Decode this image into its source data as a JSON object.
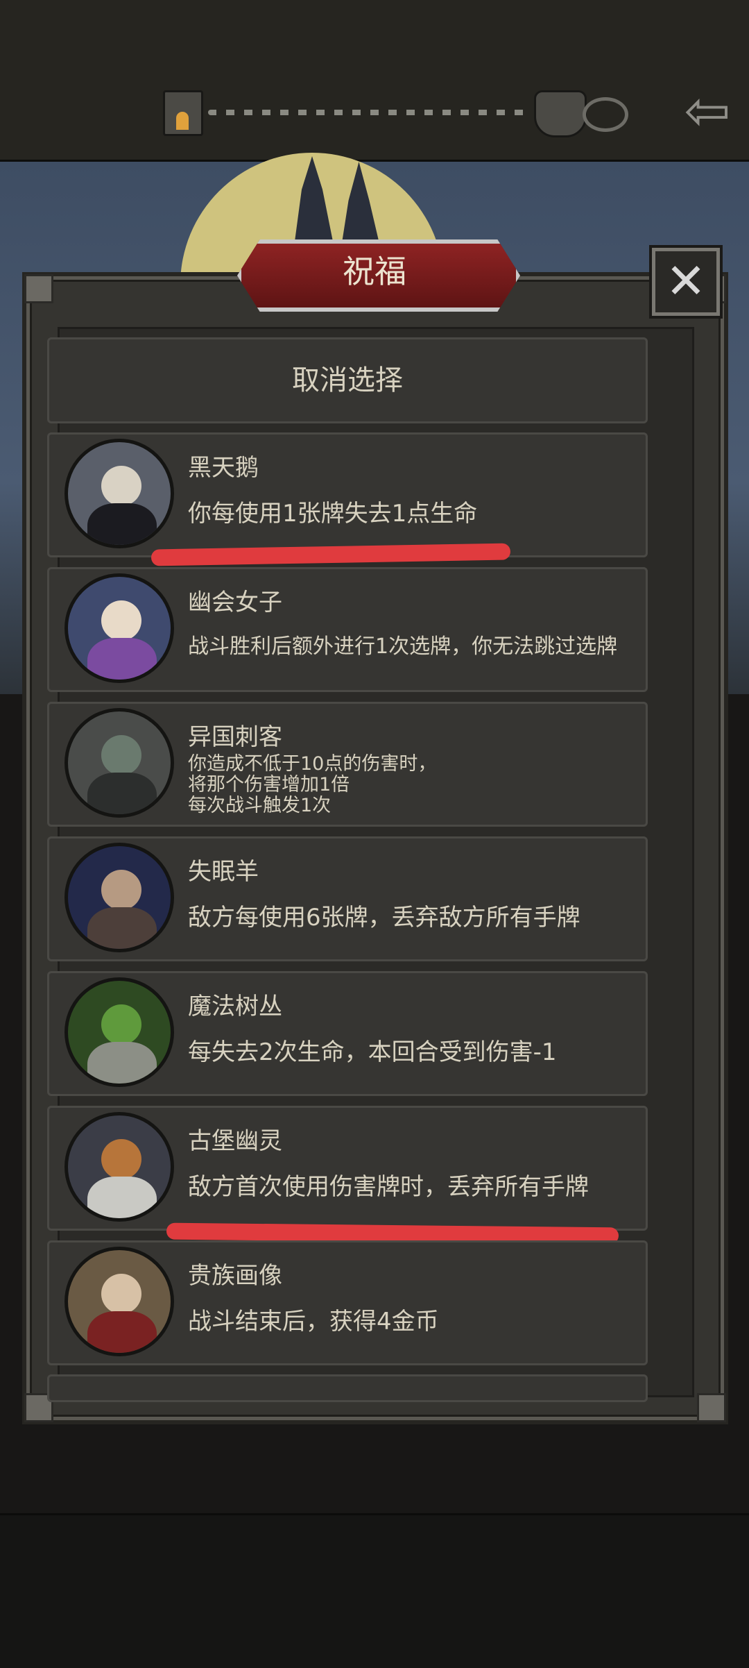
{
  "dialog": {
    "title": "祝福",
    "cancel_label": "取消选择"
  },
  "cards": [
    {
      "name": "黑天鹅",
      "desc": "你每使用1张牌失去1点生命",
      "portrait": "black-swan-portrait"
    },
    {
      "name": "幽会女子",
      "desc": "战斗胜利后额外进行1次选牌，你无法跳过选牌",
      "portrait": "tryst-woman-portrait"
    },
    {
      "name": "异国刺客",
      "desc": "你造成不低于10点的伤害时，\n将那个伤害增加1倍\n每次战斗触发1次",
      "portrait": "foreign-assassin-portrait"
    },
    {
      "name": "失眠羊",
      "desc": "敌方每使用6张牌，丢弃敌方所有手牌",
      "portrait": "insomnia-sheep-portrait"
    },
    {
      "name": "魔法树丛",
      "desc": "每失去2次生命，本回合受到伤害-1",
      "portrait": "magic-bush-portrait"
    },
    {
      "name": "古堡幽灵",
      "desc": "敌方首次使用伤害牌时，丢弃所有手牌",
      "portrait": "castle-ghost-portrait"
    },
    {
      "name": "贵族画像",
      "desc": "战斗结束后，获得4金币",
      "portrait": "noble-portrait-portrait"
    }
  ],
  "colors": {
    "accent_red": "#7c1d1d",
    "text": "#d8d2c0",
    "annotation": "#e03b3e"
  },
  "icons": {
    "tower": "castle-tower-icon",
    "boss": "boss-demon-icon",
    "eye": "eye-icon",
    "back": "back-arrow-icon",
    "close": "close-icon"
  }
}
